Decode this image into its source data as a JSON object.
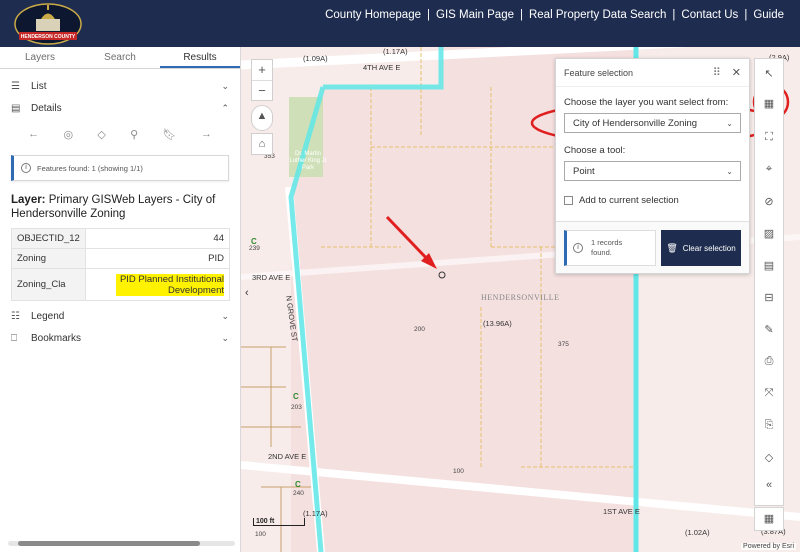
{
  "header": {
    "logo_text": "HENDERSON COUNTY",
    "links": [
      "County Homepage",
      "GIS Main Page",
      "Real Property Data Search",
      "Contact Us",
      "Guide"
    ]
  },
  "left_panel": {
    "tabs": [
      "Layers",
      "Search",
      "Results"
    ],
    "active_tab": "Results",
    "list_label": "List",
    "details_label": "Details",
    "features_found": "Features found: 1 (showing 1/1)",
    "layer_title_bold": "Layer:",
    "layer_title_rest": " Primary GISWeb Layers - City of Hendersonville Zoning",
    "attributes": [
      {
        "key": "OBJECTID_12",
        "value": "44"
      },
      {
        "key": "Zoning",
        "value": "PID"
      },
      {
        "key": "Zoning_Cla",
        "value": "PID Planned Institutional Development"
      }
    ],
    "legend_label": "Legend",
    "bookmarks_label": "Bookmarks"
  },
  "map": {
    "street_labels": [
      "4TH AVE E",
      "3RD AVE E",
      "N GROVE ST",
      "2ND AVE E",
      "1ST AVE E"
    ],
    "place_label": "HENDERSONVILLE",
    "acreage_labels": [
      "(1.09A)",
      "(1.17A)",
      "(2.9A)",
      "(13.96A)",
      "(1.17A)",
      "(1.02A)",
      "(3.87A)"
    ],
    "parcel_numbers": [
      "353",
      "239",
      "200",
      "375",
      "203",
      "100",
      "240",
      "100"
    ],
    "park_label": "Dr. Martin Luther King Jr Park",
    "scale_label": "100 ft",
    "attribution": "Powered by Esri",
    "accent_outline": "#5ee6e6"
  },
  "feature_selection": {
    "title": "Feature selection",
    "layer_prompt": "Choose the layer you want select from:",
    "layer_value": "City of Hendersonville Zoning",
    "tool_prompt": "Choose a tool:",
    "tool_value": "Point",
    "add_to_current": "Add to current selection",
    "records_found": "1 records found.",
    "clear_button": "Clear selection"
  },
  "colors": {
    "header_bg": "#1e2d4f",
    "annotation_red": "#e02020",
    "highlight_yellow": "#fff200"
  }
}
